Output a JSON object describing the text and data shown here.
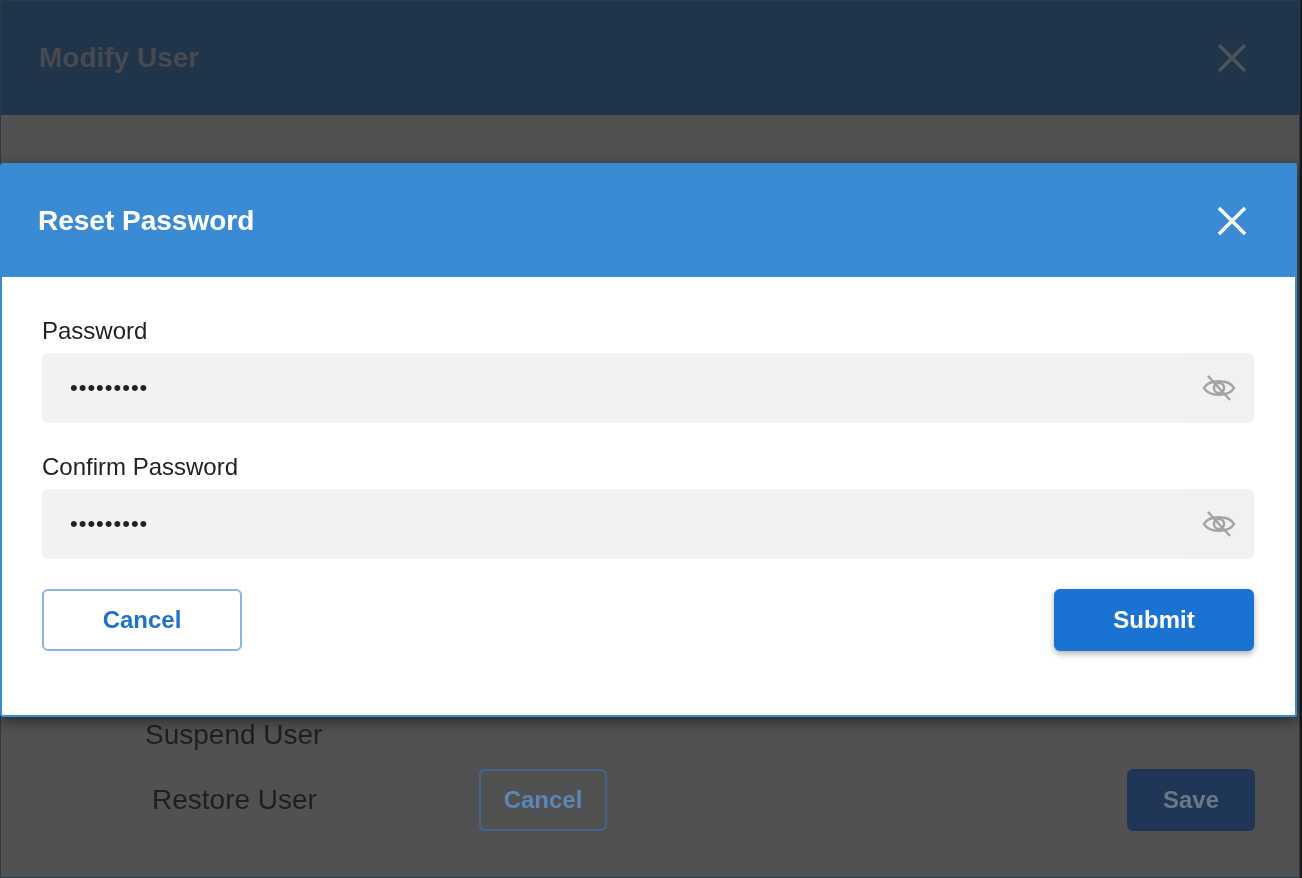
{
  "background_dialog": {
    "title": "Modify User",
    "options": [
      "Suspend User",
      "Restore User"
    ],
    "buttons": [
      {
        "label": "Cancel",
        "kind": "secondary"
      },
      {
        "label": "Save",
        "kind": "primary"
      }
    ]
  },
  "dialog": {
    "title": "Reset Password",
    "fields": [
      {
        "label": "Password",
        "value": "•••••••••",
        "masked": true
      },
      {
        "label": "Confirm Password",
        "value": "•••••••••",
        "masked": true
      }
    ],
    "buttons": [
      {
        "label": "Cancel",
        "kind": "secondary"
      },
      {
        "label": "Submit",
        "kind": "primary"
      }
    ]
  }
}
